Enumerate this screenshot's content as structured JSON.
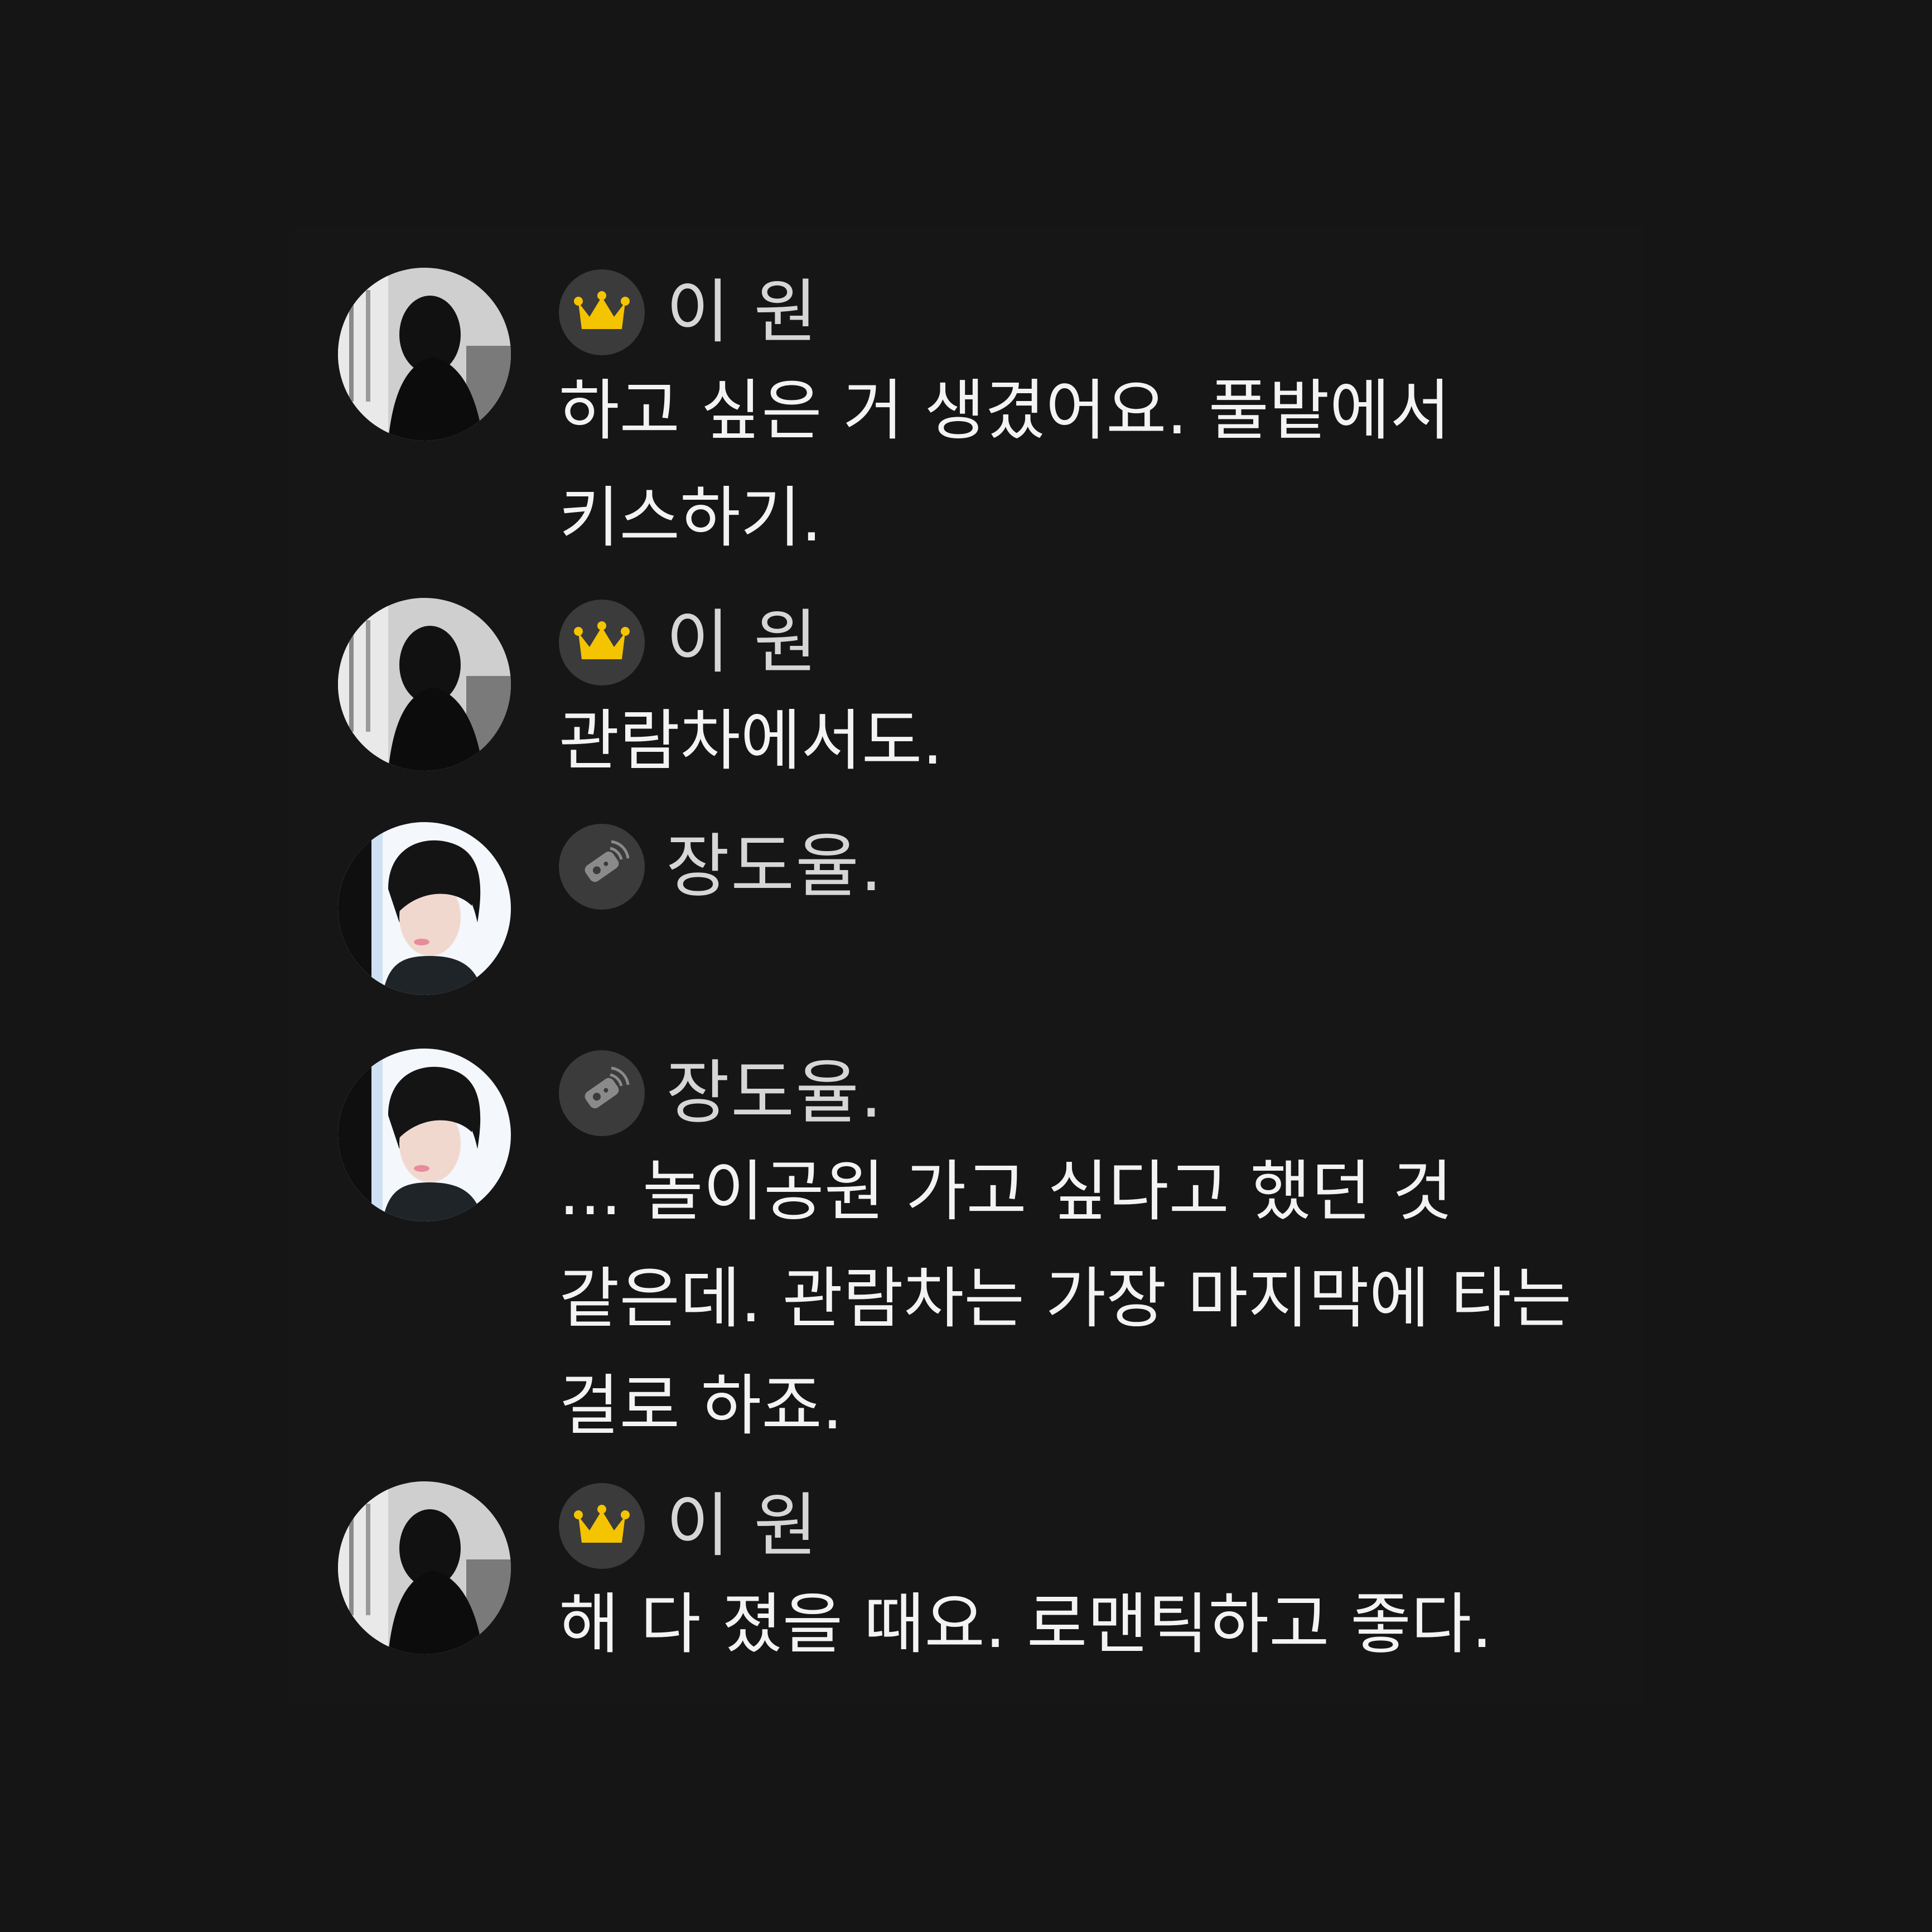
{
  "messages": [
    {
      "sender": "이 원",
      "badge": "crown-icon",
      "text": "하고 싶은 거 생겼어요. 풀밭에서 키스하기."
    },
    {
      "sender": "이 원",
      "badge": "crown-icon",
      "text": "관람차에서도."
    },
    {
      "sender": "장도율.",
      "badge": "remote-icon",
      "text": ""
    },
    {
      "sender": "장도율.",
      "badge": "remote-icon",
      "text": "... 놀이공원 가고 싶다고 했던 것 같은데. 관람차는 가장 마지막에 타는 걸로 하죠."
    },
    {
      "sender": "이 원",
      "badge": "crown-icon",
      "text": "해 다 졌을 때요. 로맨틱하고 좋다."
    }
  ],
  "colors": {
    "background": "#151515",
    "badge_bg": "#3b3b3b",
    "crown": "#f5c400",
    "text": "#f3f3f3",
    "name": "#d6d6d6"
  }
}
